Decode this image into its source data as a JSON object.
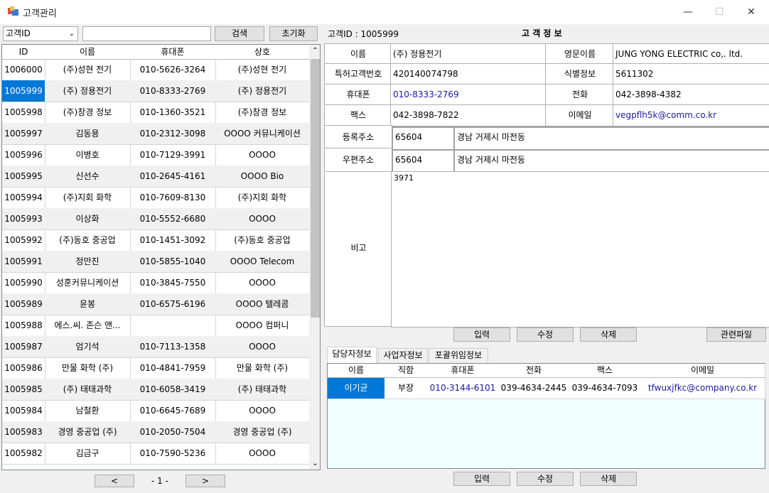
{
  "window": {
    "title": "고객관리"
  },
  "toolbar": {
    "search_field": "고객ID",
    "search_value": "",
    "search_label": "검색",
    "reset_label": "초기화",
    "customer_id_text": "고객ID : 1005999",
    "section_title": "고 객 정 보"
  },
  "grid": {
    "columns": [
      "ID",
      "이름",
      "휴대폰",
      "상호"
    ],
    "rows": [
      [
        "1006000",
        "(주)성현 전기",
        "010-5626-3264",
        "(주)성현 전기"
      ],
      [
        "1005999",
        "(주) 정용전기",
        "010-8333-2769",
        "(주) 정용전기"
      ],
      [
        "1005998",
        "(주)창경 정보",
        "010-1360-3521",
        "(주)창경 정보"
      ],
      [
        "1005997",
        "김동용",
        "010-2312-3098",
        "OOOO 커뮤니케이션"
      ],
      [
        "1005996",
        "이병호",
        "010-7129-3991",
        "OOOO"
      ],
      [
        "1005995",
        "신선수",
        "010-2645-4161",
        "OOOO Bio"
      ],
      [
        "1005994",
        "(주)지회 화학",
        "010-7609-8130",
        "(주)지회 화학"
      ],
      [
        "1005993",
        "이상화",
        "010-5552-6680",
        "OOOO"
      ],
      [
        "1005992",
        "(주)동호 중공업",
        "010-1451-3092",
        "(주)동호 중공업"
      ],
      [
        "1005991",
        "정만진",
        "010-5855-1040",
        "OOOO Telecom"
      ],
      [
        "1005990",
        "성훈커뮤니케이션",
        "010-3845-7550",
        "OOOO"
      ],
      [
        "1005989",
        "윤봉",
        "010-6575-6196",
        "OOOO 텔레콤"
      ],
      [
        "1005988",
        "에스.씨. 존슨 앤...",
        "",
        "OOOO 컴퍼니"
      ],
      [
        "1005987",
        "엄기석",
        "010-7113-1358",
        "OOOO"
      ],
      [
        "1005986",
        "만물 화학 (주)",
        "010-4841-7959",
        "만물 화학 (주)"
      ],
      [
        "1005985",
        "(주) 태태과학",
        "010-6058-3419",
        "(주) 태태과학"
      ],
      [
        "1005984",
        "남철환",
        "010-6645-7689",
        "OOOO"
      ],
      [
        "1005983",
        "경영 중공업 (주)",
        "010-2050-7504",
        "경영 중공업 (주)"
      ],
      [
        "1005982",
        "김금구",
        "010-7590-5236",
        "OOOO"
      ]
    ],
    "selected_row": 1,
    "pager": {
      "prev": "<",
      "page": "- 1 -",
      "next": ">"
    }
  },
  "detail": {
    "name_label": "이름",
    "name_value": "(주) 정용전기",
    "eng_label": "영문이름",
    "eng_value": "JUNG YONG ELECTRIC co,. ltd.",
    "patent_label": "특허고객번호",
    "patent_value": "420140074798",
    "ident_label": "식별정보",
    "ident_value": "5611302",
    "mobile_label": "휴대폰",
    "mobile_value": "010-8333-2769",
    "phone_label": "전화",
    "phone_value": "042-3898-4382",
    "fax_label": "팩스",
    "fax_value": "042-3898-7822",
    "email_label": "이메일",
    "email_value": "vegpflh5k@comm.co.kr",
    "reg_addr_label": "등록주소",
    "reg_zip": "65604",
    "reg_addr": "경남 거제시 마전동",
    "post_addr_label": "우편주소",
    "post_zip": "65604",
    "post_addr": "경남 거제시 마전동",
    "note_label": "비고",
    "note_value": "3971"
  },
  "actions": {
    "input": "입력",
    "edit": "수정",
    "delete": "삭제",
    "files": "관련파일"
  },
  "tabs": [
    "담당자정보",
    "사업자정보",
    "포괄위임정보"
  ],
  "contacts": {
    "columns": [
      "이름",
      "직함",
      "휴대폰",
      "전화",
      "팩스",
      "이메일"
    ],
    "rows": [
      [
        "이기균",
        "부장",
        "010-3144-6101",
        "039-4634-2445",
        "039-4634-7093",
        "tfwuxjfkc@company.co.kr"
      ]
    ]
  },
  "colors": {
    "selection": "#0078d7",
    "contact_bg": "#f0ffff",
    "link_text": "#1a1a9c"
  }
}
